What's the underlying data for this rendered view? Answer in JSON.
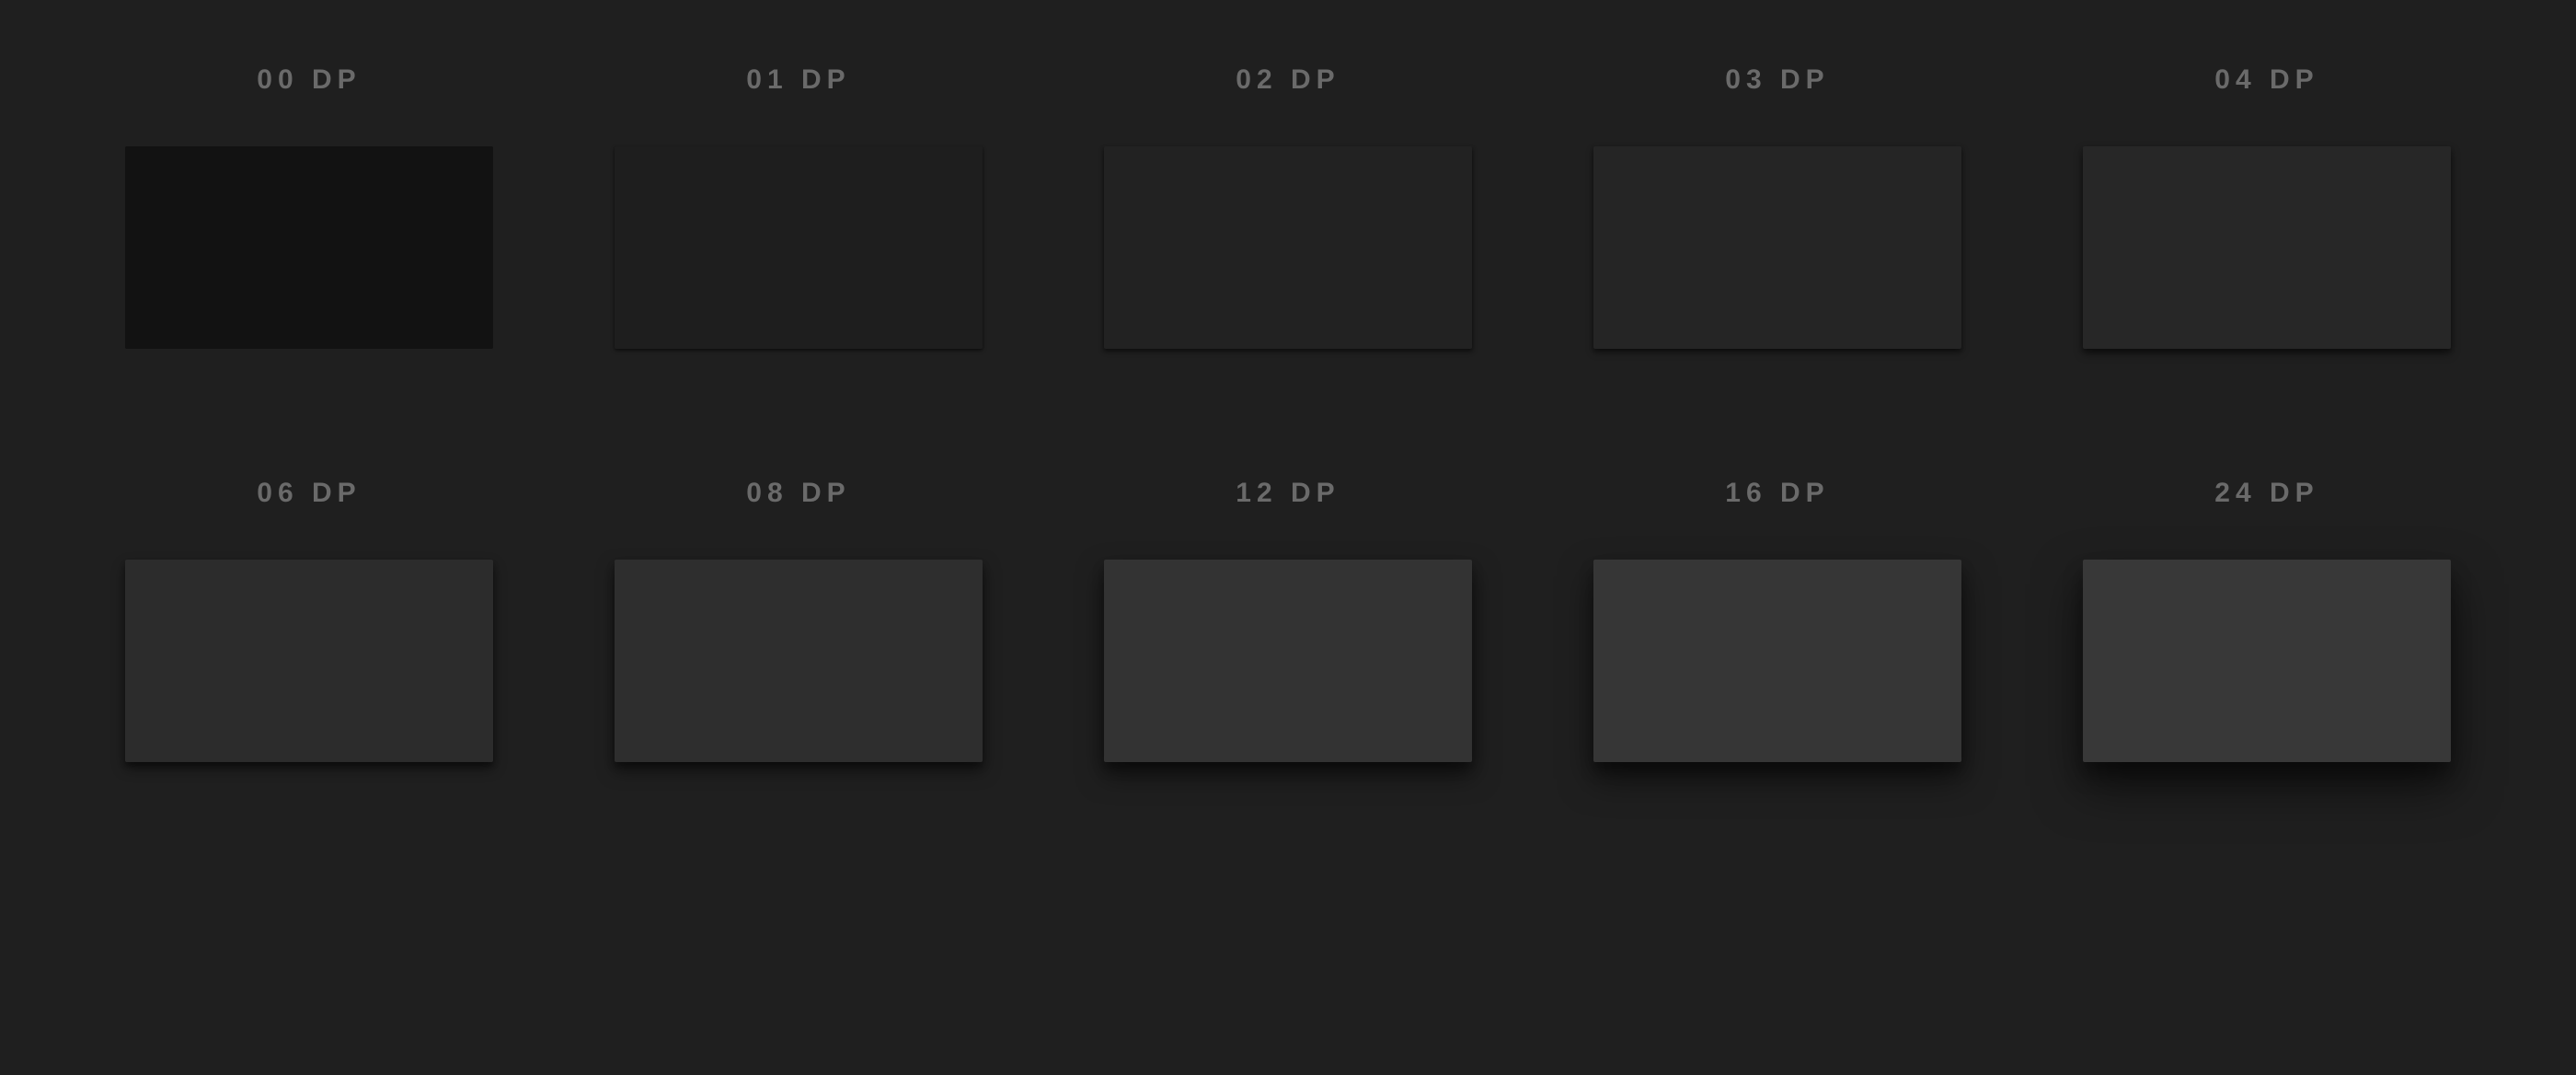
{
  "background_color": "#1f1f1f",
  "elevations": [
    {
      "label": "00 DP",
      "dp": 0,
      "surface_color": "#121212"
    },
    {
      "label": "01 DP",
      "dp": 1,
      "surface_color": "#1e1e1e"
    },
    {
      "label": "02 DP",
      "dp": 2,
      "surface_color": "#222222"
    },
    {
      "label": "03 DP",
      "dp": 3,
      "surface_color": "#252525"
    },
    {
      "label": "04 DP",
      "dp": 4,
      "surface_color": "#272727"
    },
    {
      "label": "06 DP",
      "dp": 6,
      "surface_color": "#2c2c2c"
    },
    {
      "label": "08 DP",
      "dp": 8,
      "surface_color": "#2e2e2e"
    },
    {
      "label": "12 DP",
      "dp": 12,
      "surface_color": "#333333"
    },
    {
      "label": "16 DP",
      "dp": 16,
      "surface_color": "#363636"
    },
    {
      "label": "24 DP",
      "dp": 24,
      "surface_color": "#383838"
    }
  ]
}
